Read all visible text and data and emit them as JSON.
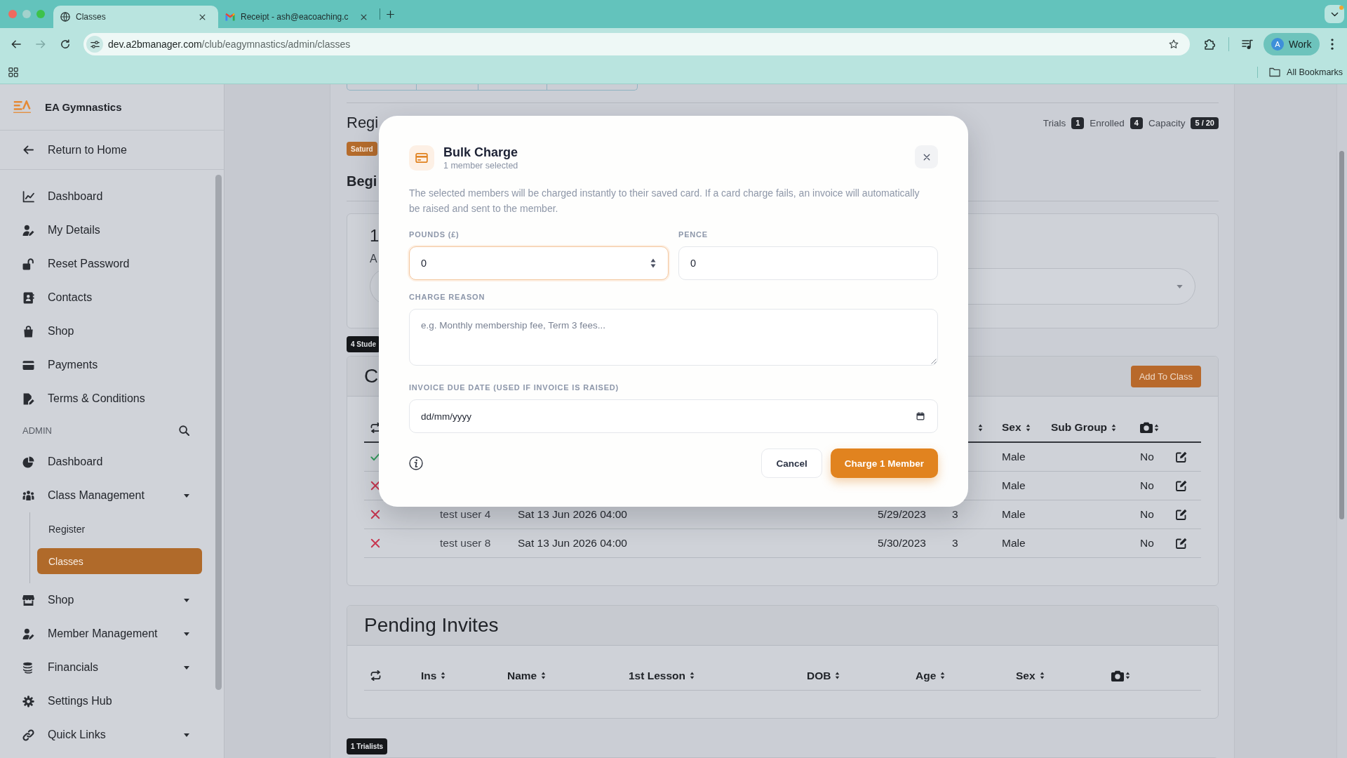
{
  "browser": {
    "tabs": [
      {
        "title": "Classes",
        "kind": "site",
        "selected": true
      },
      {
        "title": "Receipt - ash@eacoaching.c",
        "kind": "mail",
        "selected": false
      }
    ],
    "address": {
      "host": "dev.a2bmanager.com",
      "path": "/club/eagymnastics/admin/classes"
    },
    "profile": {
      "initial": "A",
      "label": "Work"
    },
    "bookmarks": {
      "label": "All Bookmarks"
    }
  },
  "sidebar": {
    "brand": "EA Gymnastics",
    "back_link": "Return to Home",
    "items": [
      {
        "label": "Dashboard",
        "selected": false
      },
      {
        "label": "My Details",
        "selected": false
      },
      {
        "label": "Reset Password",
        "selected": false
      },
      {
        "label": "Contacts",
        "selected": false
      },
      {
        "label": "Shop",
        "selected": false
      },
      {
        "label": "Payments",
        "selected": false
      },
      {
        "label": "Terms & Conditions",
        "selected": false
      }
    ],
    "section_label": "ADMIN",
    "admin_items": [
      {
        "label": "Dashboard",
        "kind": "link",
        "selected": false
      },
      {
        "label": "Class Management",
        "kind": "group",
        "selected": false,
        "children": [
          {
            "label": "Register",
            "selected": false
          },
          {
            "label": "Classes",
            "selected": true
          }
        ]
      },
      {
        "label": "Shop",
        "kind": "group",
        "selected": false
      },
      {
        "label": "Member Management",
        "kind": "group",
        "selected": false
      },
      {
        "label": "Financials",
        "kind": "group",
        "selected": false
      },
      {
        "label": "Settings Hub",
        "kind": "link",
        "selected": false
      },
      {
        "label": "Quick Links",
        "kind": "group",
        "selected": false
      }
    ]
  },
  "page": {
    "title": "Regi",
    "stats": [
      {
        "label": "Trials",
        "value": "1"
      },
      {
        "label": "Enrolled",
        "value": "4"
      },
      {
        "label": "Capacity",
        "value": "5 / 20"
      }
    ],
    "day_badge": "Saturd",
    "subtitle": "Begi",
    "summary": {
      "number": "1",
      "caption": "A"
    },
    "students_badge": "4 Stude",
    "class_table": {
      "title": "C",
      "add_button": "Add To Class",
      "columns": [
        {
          "label": "Sex"
        },
        {
          "label": "Sub Group"
        }
      ],
      "rows": [
        {
          "present": true,
          "sex": "Male",
          "photo": "No"
        },
        {
          "present": false,
          "sex": "Male",
          "photo": "No"
        },
        {
          "present": false,
          "name": "test user 4",
          "first_lesson": "Sat 13 Jun 2026 04:00",
          "dob": "5/29/2023",
          "age": "3",
          "sex": "Male",
          "photo": "No"
        },
        {
          "present": false,
          "name": "test user 8",
          "first_lesson": "Sat 13 Jun 2026 04:00",
          "dob": "5/30/2023",
          "age": "3",
          "sex": "Male",
          "photo": "No"
        }
      ]
    },
    "pending_invites": {
      "title": "Pending Invites",
      "columns": [
        {
          "label": "Ins"
        },
        {
          "label": "Name"
        },
        {
          "label": "1st Lesson"
        },
        {
          "label": "DOB"
        },
        {
          "label": "Age"
        },
        {
          "label": "Sex"
        }
      ]
    },
    "trialists_badge": "1 Trialists"
  },
  "modal": {
    "title": "Bulk Charge",
    "subtitle": "1 member selected",
    "description": "The selected members will be charged instantly to their saved card. If a card charge fails, an invoice will automatically be raised and sent to the member.",
    "amount_fields": [
      {
        "label": "POUNDS (£)",
        "value": "0",
        "kind": "number",
        "focused": true
      },
      {
        "label": "PENCE",
        "value": "0",
        "kind": "text",
        "focused": false
      }
    ],
    "reason": {
      "label": "CHARGE REASON",
      "placeholder": "e.g. Monthly membership fee, Term 3 fees..."
    },
    "due_date": {
      "label": "INVOICE DUE DATE (USED IF INVOICE IS RAISED)",
      "placeholder": "dd/mm/yyyy"
    },
    "buttons": [
      {
        "label": "Cancel",
        "kind": "secondary"
      },
      {
        "label": "Charge 1 Member",
        "kind": "primary"
      }
    ]
  }
}
